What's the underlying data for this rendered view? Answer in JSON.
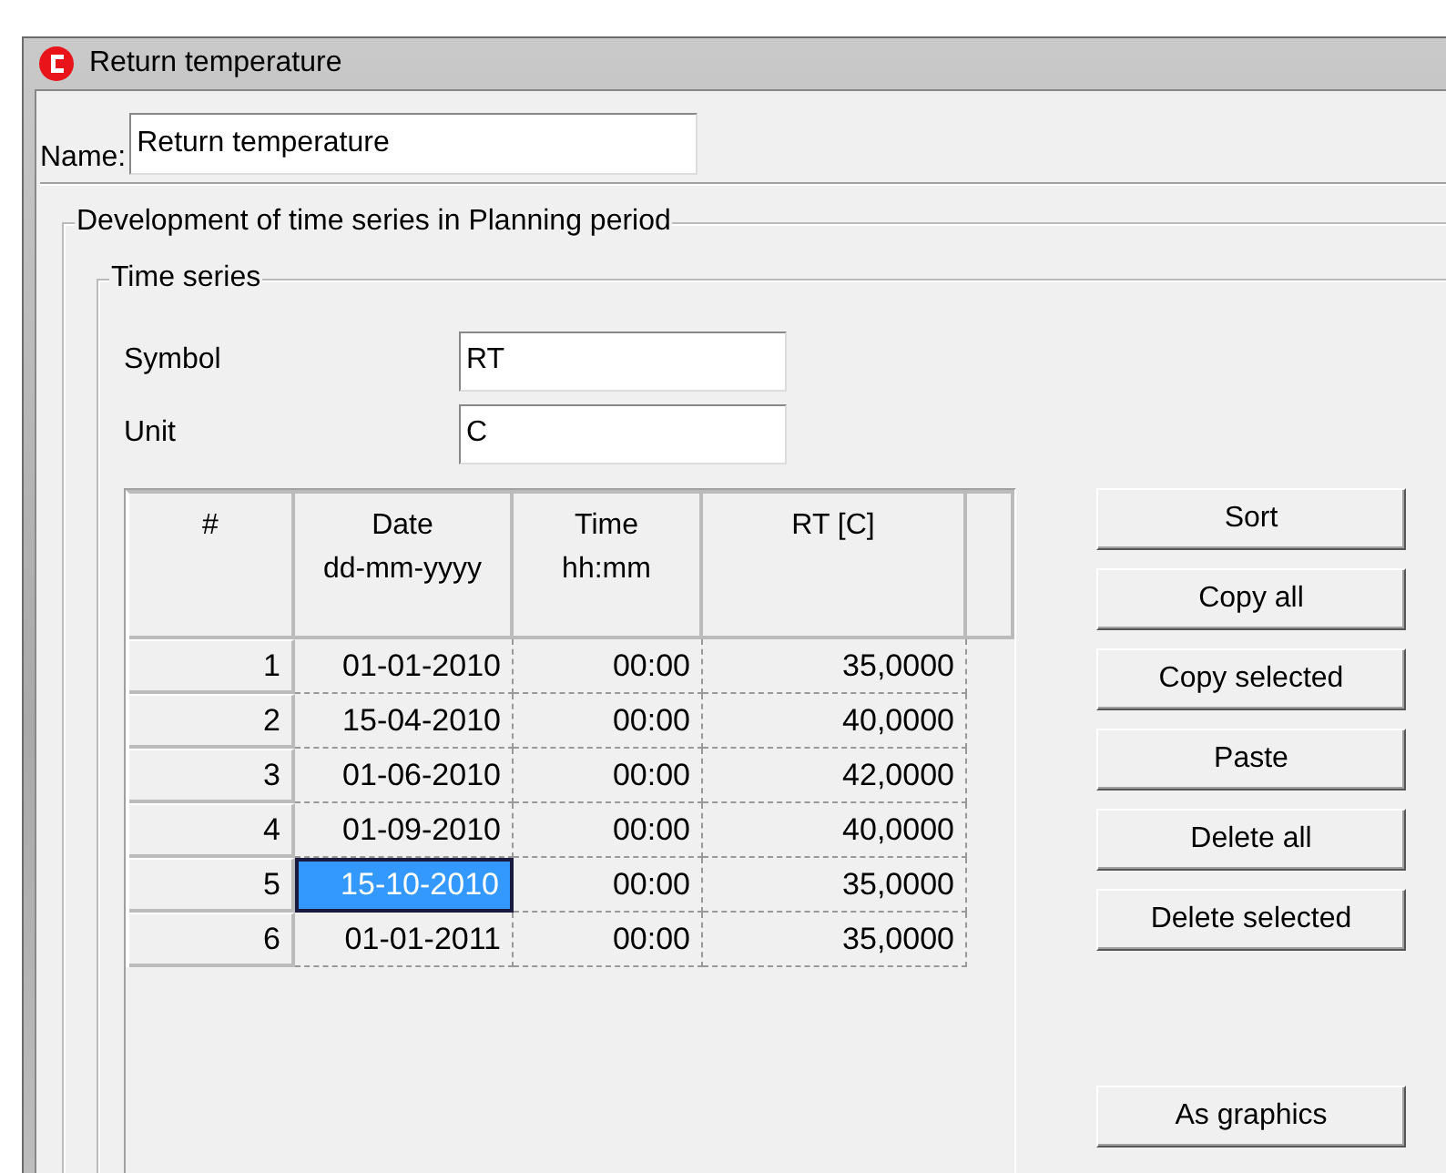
{
  "window": {
    "title": "Return temperature"
  },
  "name_field": {
    "label": "Name:",
    "value": "Return temperature"
  },
  "group": {
    "title": "Development of time series in Planning period"
  },
  "time_series": {
    "title": "Time series",
    "fields": [
      {
        "label": "Symbol",
        "value": "RT"
      },
      {
        "label": "Unit",
        "value": "C"
      }
    ]
  },
  "table": {
    "columns": [
      {
        "label": "#"
      },
      {
        "label": "Date",
        "format": "dd-mm-yyyy"
      },
      {
        "label": "Time",
        "format": "hh:mm"
      },
      {
        "label": "RT [C]"
      }
    ],
    "rows": [
      {
        "cells": [
          "1",
          "01-01-2010",
          "00:00",
          "35,0000"
        ],
        "selected": false
      },
      {
        "cells": [
          "2",
          "15-04-2010",
          "00:00",
          "40,0000"
        ],
        "selected": false
      },
      {
        "cells": [
          "3",
          "01-06-2010",
          "00:00",
          "42,0000"
        ],
        "selected": false
      },
      {
        "cells": [
          "4",
          "01-09-2010",
          "00:00",
          "40,0000"
        ],
        "selected": false
      },
      {
        "cells": [
          "5",
          "15-10-2010",
          "00:00",
          "35,0000"
        ],
        "selected": true
      },
      {
        "cells": [
          "6",
          "01-01-2011",
          "00:00",
          "35,0000"
        ],
        "selected": false
      }
    ]
  },
  "buttons": [
    "Sort",
    "Copy all",
    "Copy selected",
    "Paste",
    "Delete all",
    "Delete selected"
  ],
  "bottom_buttons": [
    "As graphics"
  ]
}
